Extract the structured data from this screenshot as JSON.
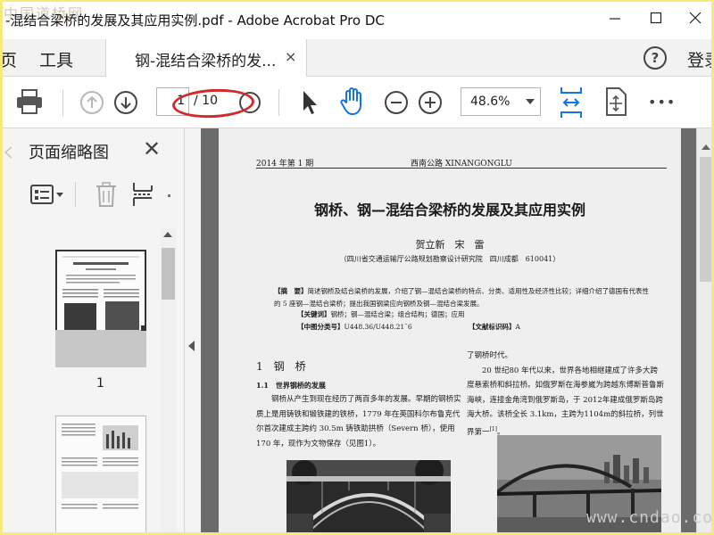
{
  "window": {
    "title": "-混结合梁桥的发展及其应用实例.pdf - Adobe Acrobat Pro DC",
    "watermark_logo": "中国道桥网"
  },
  "menubar": {
    "items": [
      {
        "label": "页"
      },
      {
        "label": "工具"
      }
    ],
    "doc_tab": {
      "label": "钢-混结合梁桥的发...",
      "close": "×"
    },
    "help": "?",
    "login": "登录"
  },
  "toolbar": {
    "page_current": "1",
    "page_total": "/ 10",
    "zoom": "48.6%",
    "more": "•••",
    "icons": [
      "print-icon",
      "prev-page-icon",
      "next-page-icon",
      "select-tool-icon",
      "hand-tool-icon",
      "zoom-out-icon",
      "zoom-in-icon",
      "fit-page-icon",
      "scroll-mode-icon",
      "more-icon"
    ]
  },
  "thumbnail_panel": {
    "title": "页面缩略图",
    "close": "✕",
    "page_number": "1"
  },
  "page": {
    "header_left": "2014 年第 1 期",
    "header_center": "西南公路 XINANGONGLU",
    "title": "钢桥、钢—混结合梁桥的发展及其应用实例",
    "authors": "贺立新　宋　雷",
    "affiliation": "（四川省交通运输厅公路规划勘察设计研究院　四川成都　610041）",
    "abstract_label": "【摘　要】",
    "abstract": "简述钢桥及结合梁桥的发展，介绍了钢—混结合梁桥的特点、分类、适用性及经济性比较；详细介绍了德国有代表性的 5 座钢—混结合梁桥；提出我国钢梁应向钢桥及钢—混结合梁发展。",
    "keywords_label": "【关键词】",
    "keywords": "钢桥；钢—混结合梁；组合结构；德国；应用",
    "cls_label": "【中图分类号】",
    "cls": "U448.36/U448.21ˉ6",
    "doccode_label": "【文献标识码】",
    "doccode": "A",
    "section1": "1　钢　桥",
    "subsection": "1.1　世界钢桥的发展",
    "body_left": "钢桥从产生到现在经历了两百多年的发展。早期的钢桥实质上是用铸铁和锻铁建的铁桥，1779 年在英国科尔布鲁克代尔首次建成主跨约 30.5m 铸铁助拱桥（Severn 桥），使用 170 年，现作为文物保存（见图1）。",
    "body_right_first": "了钢桥时代。",
    "body_right": "20 世纪80 年代以来，世界各地相继建成了许多大跨度悬索桥和斜拉桥。如俄罗斯在海参崴为跨越东博斯普鲁斯海峡，连接金角湾到俄罗斯岛，于 2012年建成俄罗斯岛跨海大桥。该桥全长 3.1km，主跨为1104m的斜拉桥，列世界第一",
    "body_right_ref": "[1]",
    "body_right_end": "。"
  },
  "watermark_bottom": "www.cndao.com",
  "colors": {
    "accent_blue": "#1473e6",
    "annotation_red": "#d22a2a",
    "viewer_bg": "#6b6b6b",
    "frame_yellow": "#f5ea7a"
  }
}
